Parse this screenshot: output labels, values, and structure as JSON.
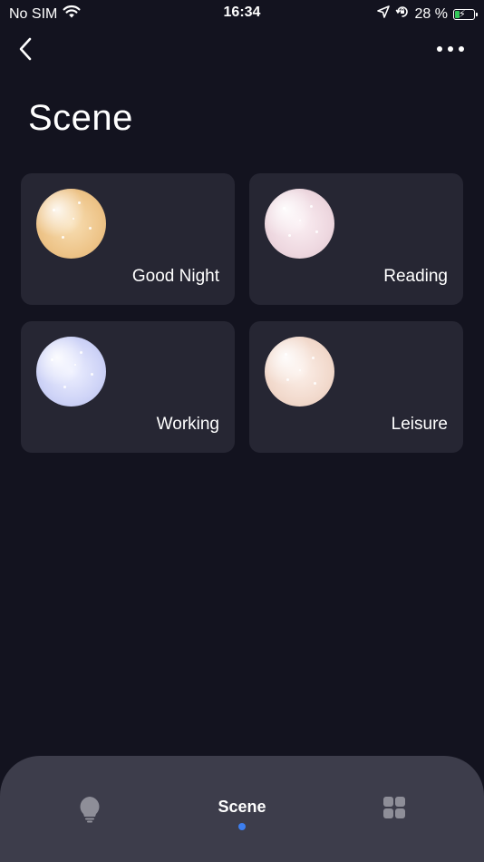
{
  "status_bar": {
    "carrier": "No SIM",
    "time": "16:34",
    "battery_percent": "28 %",
    "battery_level": 0.28,
    "battery_color": "#34c759"
  },
  "nav": {
    "back_icon": "chevron-left-icon",
    "more_icon": "ellipsis-icon"
  },
  "page": {
    "title": "Scene"
  },
  "scenes": [
    {
      "label": "Good Night",
      "orb_color": "#eec58a"
    },
    {
      "label": "Reading",
      "orb_color": "#eed8e0"
    },
    {
      "label": "Working",
      "orb_color": "#cfd4f7"
    },
    {
      "label": "Leisure",
      "orb_color": "#f2dacd"
    }
  ],
  "tab_bar": {
    "tabs": [
      {
        "icon": "lightbulb-icon",
        "label": ""
      },
      {
        "icon": "",
        "label": "Scene",
        "active": true
      },
      {
        "icon": "grid-icon",
        "label": ""
      }
    ],
    "active_indicator_color": "#3d7ff0"
  },
  "colors": {
    "background": "#13131f",
    "card": "#262633",
    "tab_bar": "#3d3d4b"
  }
}
